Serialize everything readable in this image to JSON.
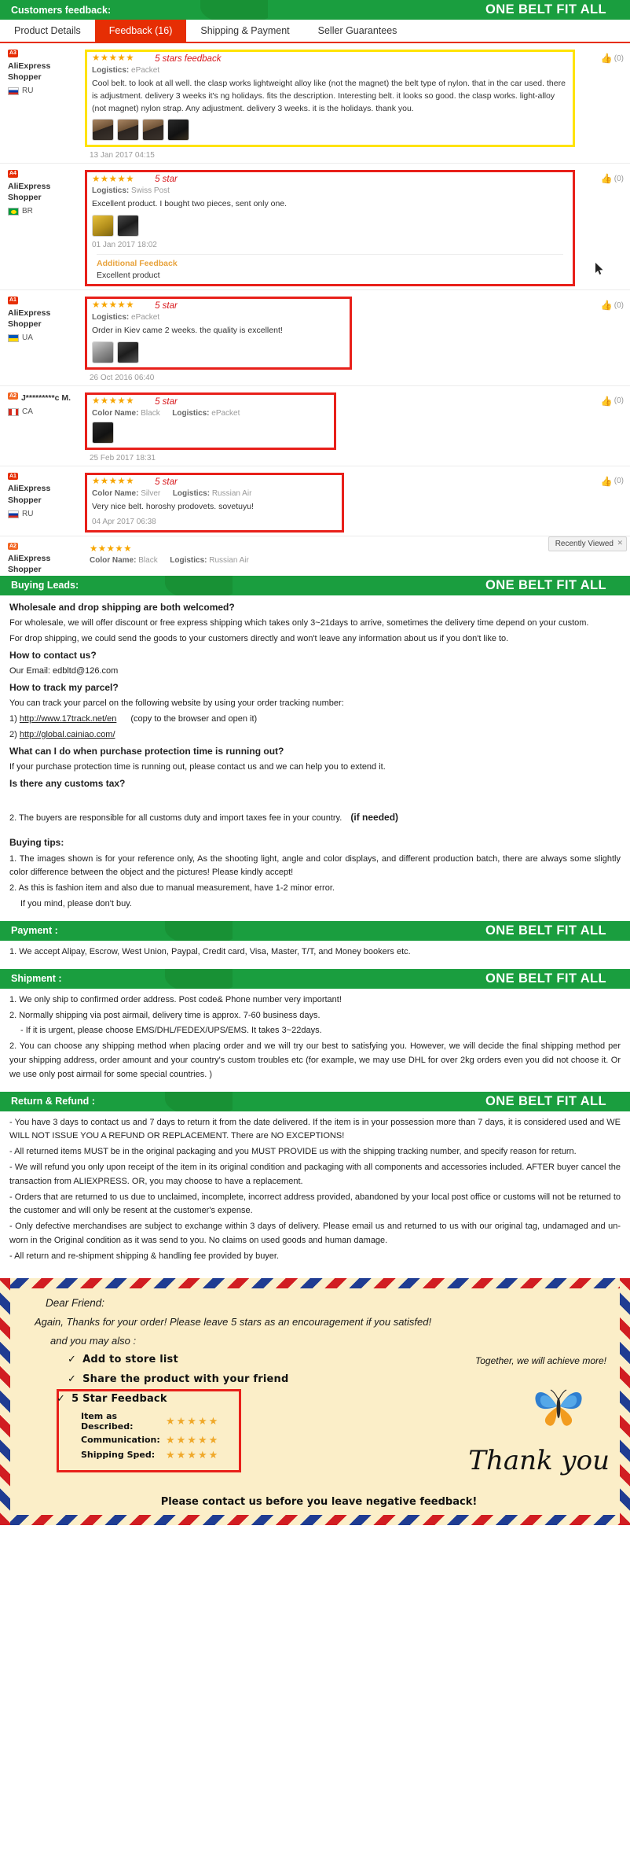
{
  "banners": {
    "feedback": {
      "left": "Customers feedback:",
      "brand": "ONE BELT FIT ALL"
    },
    "buying": {
      "left": "Buying Leads:",
      "brand": "ONE BELT FIT ALL"
    },
    "payment": {
      "left": "Payment :",
      "brand": "ONE BELT FIT ALL"
    },
    "shipment": {
      "left": "Shipment :",
      "brand": "ONE BELT FIT ALL"
    },
    "return": {
      "left": "Return & Refund :",
      "brand": "ONE BELT FIT ALL"
    }
  },
  "tabs": [
    {
      "label": "Product Details",
      "active": false
    },
    {
      "label": "Feedback (16)",
      "active": true
    },
    {
      "label": "Shipping & Payment",
      "active": false
    },
    {
      "label": "Seller Guarantees",
      "active": false
    }
  ],
  "reviews": [
    {
      "badge": "A3",
      "user": "AliExpress Shopper",
      "country": "RU",
      "flag": "flag-ru",
      "stars": "★★★★★",
      "annotation": "5 stars feedback",
      "box": "yellow",
      "color_label": "",
      "color_value": "",
      "logistics_label": "Logistics:",
      "logistics_value": "ePacket",
      "text": "Cool belt. to look at all well. the clasp works lightweight alloy like (not the magnet) the belt type of nylon. that in the car used. there is adjustment. delivery 3 weeks it's ng holidays. fits the description. Interesting belt. it looks so good. the clasp works. light-alloy (not magnet) nylon strap. Any adjustment. delivery 3 weeks. it is the holidays. thank you.",
      "thumbs": [
        "t-brown",
        "t-brown",
        "t-brown",
        "t-black"
      ],
      "date": "13 Jan 2017 04:15",
      "helpful": "(0)",
      "additional_title": "",
      "additional_text": ""
    },
    {
      "badge": "A4",
      "user": "AliExpress Shopper",
      "country": "BR",
      "flag": "flag-br",
      "stars": "★★★★★",
      "annotation": "5 star",
      "box": "red",
      "color_label": "",
      "color_value": "",
      "logistics_label": "Logistics:",
      "logistics_value": "Swiss Post",
      "text": "Excellent product. I bought two pieces, sent only one.",
      "thumbs": [
        "t-yellow",
        "t-dark"
      ],
      "date": "01 Jan 2017 18:02",
      "helpful": "(0)",
      "additional_title": "Additional Feedback",
      "additional_text": "Excellent product"
    },
    {
      "badge": "A1",
      "user": "AliExpress Shopper",
      "country": "UA",
      "flag": "flag-ua",
      "stars": "★★★★★",
      "annotation": "5 star",
      "box": "red",
      "color_label": "",
      "color_value": "",
      "logistics_label": "Logistics:",
      "logistics_value": "ePacket",
      "text": "Order in Kiev came 2 weeks. the quality is excellent!",
      "thumbs": [
        "t-grey",
        "t-dark"
      ],
      "date": "26 Oct 2016 06:40",
      "helpful": "(0)",
      "additional_title": "",
      "additional_text": ""
    },
    {
      "badge": "A2",
      "user": "J*********c M.",
      "country": "CA",
      "flag": "flag-ca",
      "stars": "★★★★★",
      "annotation": "5 star",
      "box": "red",
      "color_label": "Color Name:",
      "color_value": "Black",
      "logistics_label": "Logistics:",
      "logistics_value": "ePacket",
      "text": "",
      "thumbs": [
        "t-black"
      ],
      "date": "25 Feb 2017 18:31",
      "helpful": "(0)",
      "additional_title": "",
      "additional_text": ""
    },
    {
      "badge": "A1",
      "user": "AliExpress Shopper",
      "country": "RU",
      "flag": "flag-ru",
      "stars": "★★★★★",
      "annotation": "5 star",
      "box": "red",
      "color_label": "Color Name:",
      "color_value": "Silver",
      "logistics_label": "Logistics:",
      "logistics_value": "Russian Air",
      "text": "Very nice belt. horoshy prodovets. sovetuyu!",
      "thumbs": [],
      "date": "04 Apr 2017 06:38",
      "helpful": "(0)",
      "additional_title": "",
      "additional_text": ""
    },
    {
      "badge": "A2",
      "user": "AliExpress Shopper",
      "country": "",
      "flag": "flag-ru",
      "stars": "★★★★★",
      "annotation": "",
      "box": "none",
      "color_label": "Color Name:",
      "color_value": "Black",
      "logistics_label": "Logistics:",
      "logistics_value": "Russian Air",
      "text": "",
      "thumbs": [],
      "date": "",
      "helpful": "",
      "additional_title": "",
      "additional_text": ""
    }
  ],
  "recently_viewed": {
    "label": "Recently Viewed",
    "close": "✕"
  },
  "buying_leads": {
    "q1": "Wholesale and drop shipping are both welcomed?",
    "a1a": "For wholesale, we will offer discount or free express shipping which takes only 3~21days to arrive, sometimes the delivery time depend on your custom.",
    "a1b": "For drop shipping, we could send the goods to your customers directly and won't leave any information about us if you don't like to.",
    "q2": "How to contact us?",
    "a2": "Our Email: edbltd@126.com",
    "q3": "How to track my parcel?",
    "a3": "You can track your parcel on the following website by using your order tracking number:",
    "link1_prefix": "1) ",
    "link1": "http://www.17track.net/en",
    "link1_note": "(copy to the browser and open it)",
    "link2_prefix": "2) ",
    "link2": "http://global.cainiao.com/",
    "q4": "What can I do when purchase protection time is running out?",
    "a4": "If your purchase protection time is running out, please contact us and we can help you to extend it.",
    "q5": "Is there any customs tax?",
    "a5": "2. The buyers are responsible for all customs duty and import taxes fee in your country.",
    "a5_bold": "(if needed)",
    "tips_title": "Buying tips:",
    "tip1": "1. The images shown is for your reference only, As the shooting light, angle and color displays, and different production batch, there are always some slightly color difference between the object and the pictures! Please kindly accept!",
    "tip2": "2. As this is fashion item and also due to manual measurement, have 1-2 minor error.",
    "tip3": "If you mind, please don't buy."
  },
  "payment": {
    "line1": "1. We accept Alipay, Escrow, West Union, Paypal, Credit card, Visa, Master, T/T, and Money bookers etc."
  },
  "shipment": {
    "line1": "1. We only ship to confirmed order address. Post code& Phone number very important!",
    "line2": "2. Normally shipping via post airmail, delivery time is approx. 7-60 business days.",
    "line3": "- If it is urgent, please choose EMS/DHL/FEDEX/UPS/EMS. It takes 3~22days.",
    "line4": "2. You can choose any shipping method when placing order and we will try our best to satisfying you. However, we will decide the final shipping method per your shipping address, order amount and your country's custom troubles etc (for example, we may use DHL for over 2kg orders even you did not choose it. Or we use only post airmail for some special countries. )"
  },
  "returns": {
    "line1": "- You have 3 days to contact us and 7 days to return it from the date delivered. If the item is in your possession more than 7 days, it is considered used and WE WILL NOT ISSUE YOU A REFUND OR REPLACEMENT. There are NO EXCEPTIONS!",
    "line2": "- All returned items MUST be in the original packaging and you MUST PROVIDE us with the shipping tracking number, and specify reason for return.",
    "line3": "- We will refund you only upon receipt of the item in its original condition and packaging with all components and accessories included. AFTER buyer cancel the transaction from ALIEXPRESS. OR, you may choose to have a replacement.",
    "line4": "- Orders that are returned to us due to unclaimed, incomplete, incorrect address provided, abandoned by your local post office or customs will not be returned to the customer and will only be resent at the customer's expense.",
    "line5": "- Only defective merchandises are subject to exchange within 3 days of delivery. Please email us and returned to us with our original tag, undamaged and un-worn in the Original condition as it was send to you. No claims on used goods and human damage.",
    "line6": "- All return and re-shipment shipping & handling fee provided by buyer."
  },
  "envelope": {
    "dear": "Dear Friend:",
    "again": "Again, Thanks for your order! Please leave 5 stars as an encouragement if you satisfed!",
    "also": "and you may also :",
    "check1": "Add to store list",
    "check2": "Share the product with your friend",
    "tick": "✓",
    "rating_title": "5 Star Feedback",
    "rating_rows": [
      {
        "label": "Item as Described:",
        "stars": "★★★★★"
      },
      {
        "label": "Communication:",
        "stars": "★★★★★"
      },
      {
        "label": "Shipping Sped:",
        "stars": "★★★★★"
      }
    ],
    "together": "Together, we will achieve more!",
    "thank_you": "Thank you",
    "footer": "Please contact us before you leave negative feedback!"
  }
}
